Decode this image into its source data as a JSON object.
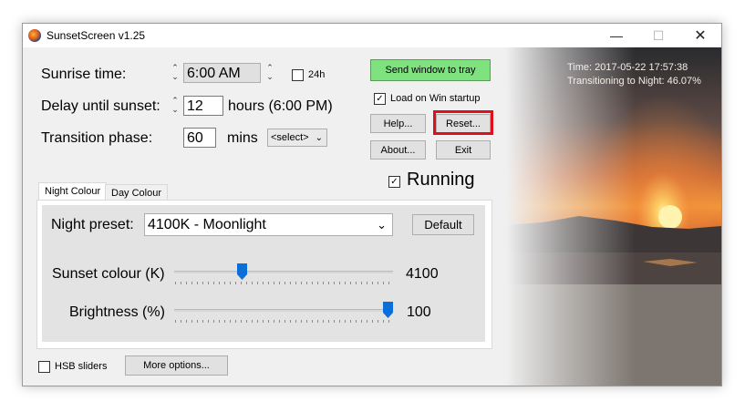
{
  "window": {
    "title": "SunsetScreen v1.25",
    "min_glyph": "—",
    "max_glyph": "☐",
    "close_glyph": "✕"
  },
  "settings": {
    "sunrise_label": "Sunrise time:",
    "sunrise_value": "6:00 AM",
    "h24_label": "24h",
    "delay_label": "Delay until sunset:",
    "delay_value": "12",
    "delay_unit": "hours  (6:00 PM)",
    "transition_label": "Transition phase:",
    "transition_value": "60",
    "transition_unit": "mins",
    "select_value": "<select>",
    "spin_up": "⌃",
    "spin_down": "⌄"
  },
  "buttons": {
    "tray": "Send window to tray",
    "load_startup": "Load on Win startup",
    "help": "Help...",
    "reset": "Reset...",
    "about": "About...",
    "exit": "Exit",
    "default": "Default",
    "more_options": "More options..."
  },
  "running": {
    "label": "Running",
    "checked": true,
    "check_glyph": "✓"
  },
  "tabs": [
    {
      "label": "Night Colour",
      "active": true
    },
    {
      "label": "Day Colour",
      "active": false
    }
  ],
  "night": {
    "preset_label": "Night preset:",
    "preset_value": "4100K - Moonlight",
    "sunset_colour_label": "Sunset colour (K)",
    "sunset_colour_value": "4100",
    "sunset_colour_fraction": 0.3,
    "brightness_label": "Brightness (%)",
    "brightness_value": "100",
    "brightness_fraction": 1.0
  },
  "footer": {
    "hsb_label": "HSB sliders"
  },
  "overlay": {
    "time": "Time: 2017-05-22 17:57:38",
    "transition": "Transitioning to Night: 46.07%"
  },
  "colors": {
    "tray_button": "#7ee27e",
    "highlight": "#e0101a",
    "slider_thumb": "#0a6fd8"
  }
}
